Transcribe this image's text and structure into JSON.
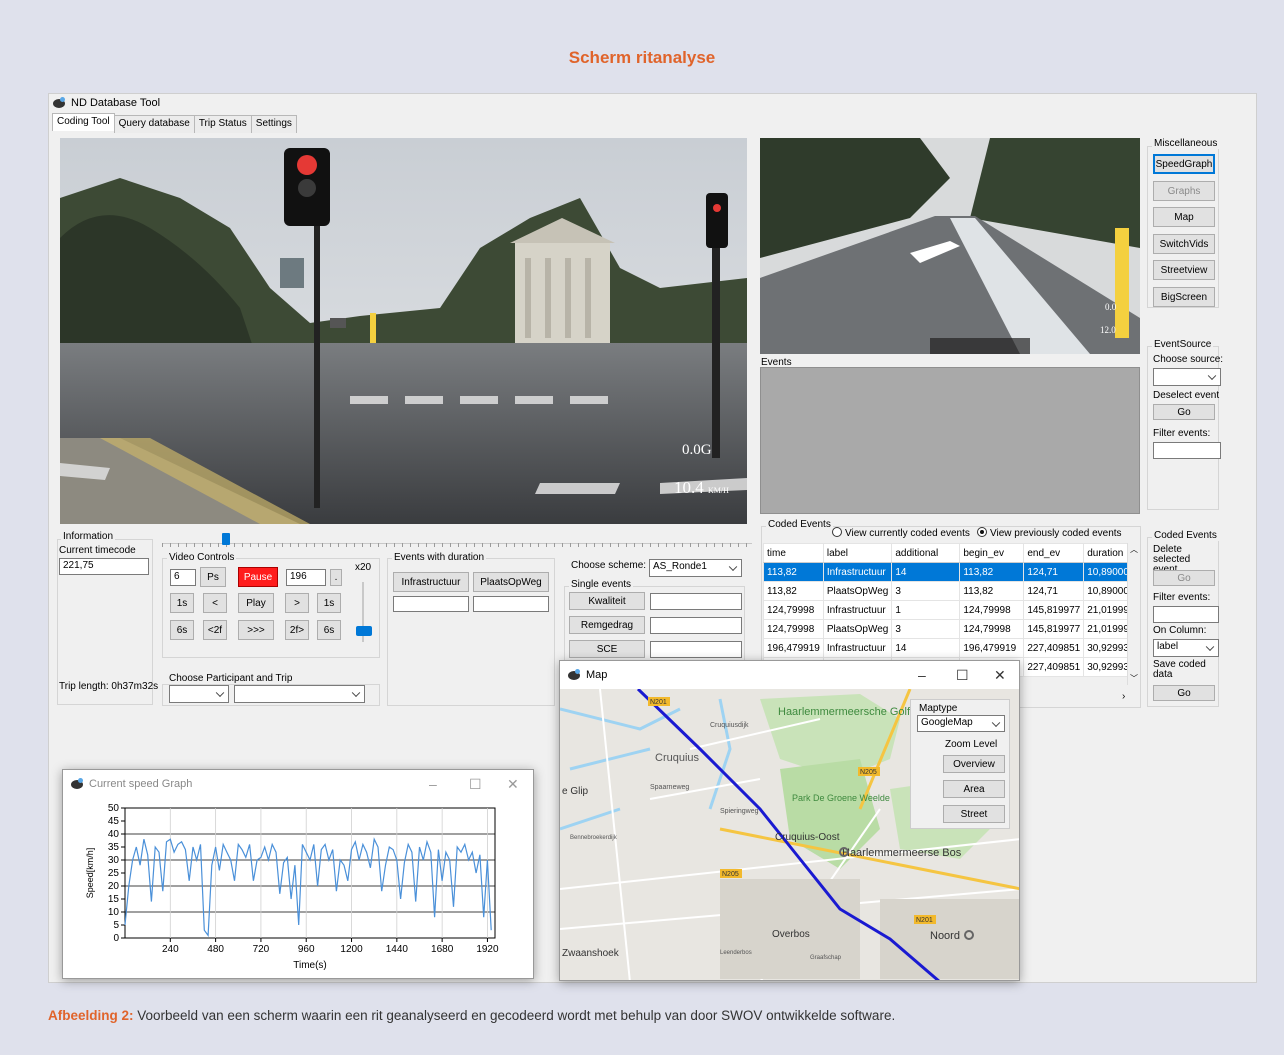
{
  "page_title": "Scherm ritanalyse",
  "caption": {
    "label": "Afbeelding 2:",
    "text": " Voorbeeld van een scherm waarin een rit geanalyseerd en gecodeerd wordt met behulp van door SWOV ontwikkelde software."
  },
  "app": {
    "title": "ND Database Tool",
    "tabs": [
      "Coding Tool",
      "Query database",
      "Trip Status",
      "Settings"
    ],
    "video_main": {
      "g_force": "0.0G",
      "speed": "10.4",
      "speed_unit": "KM/H"
    },
    "video_second": {
      "g_force": "0.0",
      "speed": "12.0"
    },
    "misc": {
      "title": "Miscellaneous",
      "buttons": [
        "SpeedGraph",
        "Graphs",
        "Map",
        "SwitchVids",
        "Streetview",
        "BigScreen"
      ]
    },
    "events_label": "Events",
    "event_source": {
      "title": "EventSource",
      "choose": "Choose source:",
      "deselect": "Deselect event",
      "go": "Go",
      "filter": "Filter events:"
    },
    "information": {
      "title": "Information",
      "timecode_label": "Current timecode",
      "timecode": "221,75",
      "trip_length": "Trip length: 0h37m32s"
    },
    "video_controls": {
      "title": "Video Controls",
      "step": "6",
      "ps": "Ps",
      "pause": "Pause",
      "frame": "196",
      "dot": ".",
      "speed_mult": "x20",
      "row2": [
        "1s",
        "<",
        "Play",
        ">",
        "1s"
      ],
      "row3": [
        "6s",
        "<2f",
        ">>>",
        "2f>",
        "6s"
      ]
    },
    "participant": {
      "title": "Choose Participant and Trip"
    },
    "duration_events": {
      "title": "Events with duration",
      "b1": "Infrastructuur",
      "b2": "PlaatsOpWeg"
    },
    "scheme": {
      "label": "Choose scheme:",
      "value": "AS_Ronde1",
      "single": "Single events",
      "buttons": [
        "Kwaliteit",
        "Remgedrag",
        "SCE"
      ]
    },
    "coded_events": {
      "title": "Coded Events",
      "radio1": "View currently coded events",
      "radio2": "View previously coded events",
      "columns": [
        "time",
        "label",
        "additional",
        "begin_ev",
        "end_ev",
        "duration"
      ],
      "rows": [
        [
          "113,82",
          "Infrastructuur",
          "14",
          "113,82",
          "124,71",
          "10,89000"
        ],
        [
          "113,82",
          "PlaatsOpWeg",
          "3",
          "113,82",
          "124,71",
          "10,89000"
        ],
        [
          "124,79998",
          "Infrastructuur",
          "1",
          "124,79998",
          "145,819977",
          "21,01999"
        ],
        [
          "124,79998",
          "PlaatsOpWeg",
          "3",
          "124,79998",
          "145,819977",
          "21,01999"
        ],
        [
          "196,479919",
          "Infrastructuur",
          "14",
          "196,479919",
          "227,409851",
          "30,92993"
        ],
        [
          "",
          "",
          "",
          "",
          "227,409851",
          "30,92993"
        ]
      ]
    },
    "coded_panel": {
      "title": "Coded Events",
      "delete": "Delete selected event",
      "go": "Go",
      "filter": "Filter events:",
      "on_column": "On Column:",
      "column_value": "label",
      "save": "Save coded data",
      "go2": "Go"
    }
  },
  "speed_window": {
    "title": "Current speed Graph"
  },
  "map_window": {
    "title": "Map",
    "maptype_label": "Maptype",
    "maptype": "GoogleMap",
    "zoom_label": "Zoom Level",
    "zoom_buttons": [
      "Overview",
      "Area",
      "Street"
    ],
    "places": [
      "Haarlemmermeersche Golfclub",
      "Cruquius",
      "Park De Groene Weelde",
      "Cruquius-Oost",
      "Haarlemmermeerse Bos",
      "Overbos",
      "Noord",
      "Zwaanshoek",
      "e Glip",
      "Cruquiusdijk",
      "Spaarneweg",
      "Bennebroekerdijk",
      "Spieringweg",
      "Leenderbos",
      "Graafschap"
    ],
    "roads": [
      "N201",
      "N205",
      "N205",
      "N201"
    ]
  },
  "chart_data": {
    "type": "line",
    "title": "",
    "xlabel": "Time(s)",
    "ylabel": "Speed[km/h]",
    "xlim": [
      0,
      1960
    ],
    "ylim": [
      0,
      50
    ],
    "xticks": [
      240,
      480,
      720,
      960,
      1200,
      1440,
      1680,
      1920
    ],
    "yticks": [
      0,
      5,
      10,
      15,
      20,
      25,
      30,
      35,
      40,
      45,
      50
    ],
    "grid": true,
    "series": [
      {
        "color": "#4a90d9",
        "x": [
          0,
          20,
          40,
          60,
          80,
          100,
          120,
          140,
          160,
          180,
          200,
          220,
          240,
          260,
          280,
          300,
          320,
          340,
          360,
          380,
          400,
          420,
          440,
          460,
          480,
          500,
          520,
          540,
          560,
          580,
          600,
          620,
          640,
          660,
          680,
          700,
          720,
          740,
          760,
          780,
          800,
          820,
          840,
          860,
          880,
          900,
          920,
          940,
          960,
          980,
          1000,
          1020,
          1040,
          1060,
          1080,
          1100,
          1120,
          1140,
          1160,
          1180,
          1200,
          1220,
          1240,
          1260,
          1280,
          1300,
          1320,
          1340,
          1360,
          1380,
          1400,
          1420,
          1440,
          1460,
          1480,
          1500,
          1520,
          1540,
          1560,
          1580,
          1600,
          1620,
          1640,
          1660,
          1680,
          1700,
          1720,
          1740,
          1760,
          1780,
          1800,
          1820,
          1840,
          1860,
          1880,
          1900,
          1920,
          1940
        ],
        "y": [
          5,
          20,
          30,
          35,
          28,
          38,
          32,
          14,
          35,
          33,
          18,
          37,
          38,
          33,
          36,
          37,
          34,
          22,
          35,
          30,
          36,
          3,
          1,
          28,
          35,
          26,
          36,
          33,
          30,
          22,
          36,
          34,
          31,
          36,
          22,
          30,
          31,
          35,
          30,
          36,
          33,
          17,
          29,
          31,
          15,
          28,
          5,
          36,
          33,
          30,
          36,
          20,
          34,
          36,
          30,
          34,
          18,
          30,
          28,
          22,
          34,
          37,
          30,
          36,
          33,
          27,
          38,
          35,
          18,
          28,
          35,
          34,
          30,
          15,
          29,
          36,
          33,
          14,
          35,
          30,
          37,
          33,
          8,
          34,
          22,
          33,
          30,
          12,
          35,
          33,
          36,
          30,
          33,
          25,
          32,
          8,
          30,
          3
        ]
      }
    ]
  }
}
